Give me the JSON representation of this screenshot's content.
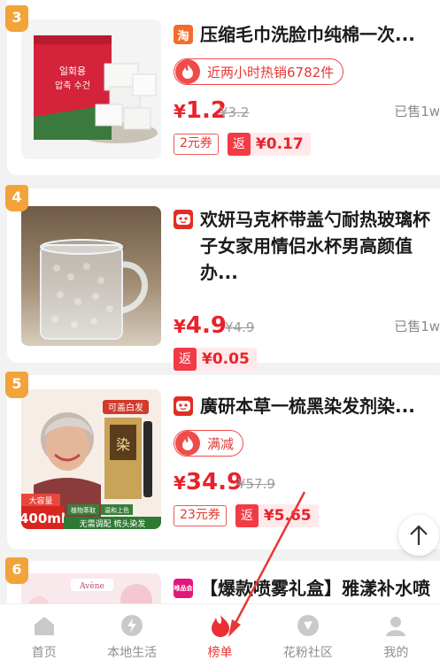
{
  "products": [
    {
      "rank": "3",
      "platform_icon": "taobao-icon",
      "platform_glyph": "淘",
      "title": "压缩毛巾洗脸巾纯棉一次...",
      "hot_text": "近两小时热销6782件",
      "price_symbol": "¥",
      "price": "1.2",
      "original_price": "¥3.2",
      "sold": "已售1w",
      "coupon": "2元券",
      "rebate_label": "返",
      "rebate": "¥0.17",
      "thumb_text_1": "일회용",
      "thumb_text_2": "압축 수건"
    },
    {
      "rank": "4",
      "platform_icon": "pinduoduo-icon",
      "title": "欢妍马克杯带盖勺耐热玻璃杯子女家用情侣水杯男高颜值办...",
      "price_symbol": "¥",
      "price": "4.9",
      "original_price": "¥4.9",
      "sold": "已售1w",
      "rebate_label": "返",
      "rebate": "¥0.05"
    },
    {
      "rank": "5",
      "platform_icon": "pinduoduo-icon",
      "title": "廣研本草一梳黑染发剂染...",
      "hot_text": "满减",
      "price_symbol": "¥",
      "price": "34.9",
      "original_price": "¥57.9",
      "coupon": "23元券",
      "rebate_label": "返",
      "rebate": "¥5.65",
      "thumb_badge": "可盖白发",
      "thumb_box_glyph": "染",
      "thumb_capacity": "大容量",
      "thumb_volume": "400ml",
      "thumb_tag_1": "植物萃取",
      "thumb_tag_2": "温和上色",
      "thumb_slogan": "无需调配 梳头染发"
    },
    {
      "rank": "6",
      "platform_icon": "vip-icon",
      "platform_glyph": "唯品会",
      "title": "【爆款喷雾礼盒】雅漾补水喷",
      "thumb_brand": "Avène"
    }
  ],
  "tabbar": [
    {
      "label": "首页",
      "icon": "home-icon"
    },
    {
      "label": "本地生活",
      "icon": "lightning-icon"
    },
    {
      "label": "榜单",
      "icon": "flame-icon",
      "active": true
    },
    {
      "label": "花粉社区",
      "icon": "community-icon"
    },
    {
      "label": "我的",
      "icon": "profile-icon"
    }
  ],
  "colors": {
    "accent": "#e8232b",
    "rank_badge": "#f2a33a",
    "annotation_arrow": "#e53935"
  }
}
